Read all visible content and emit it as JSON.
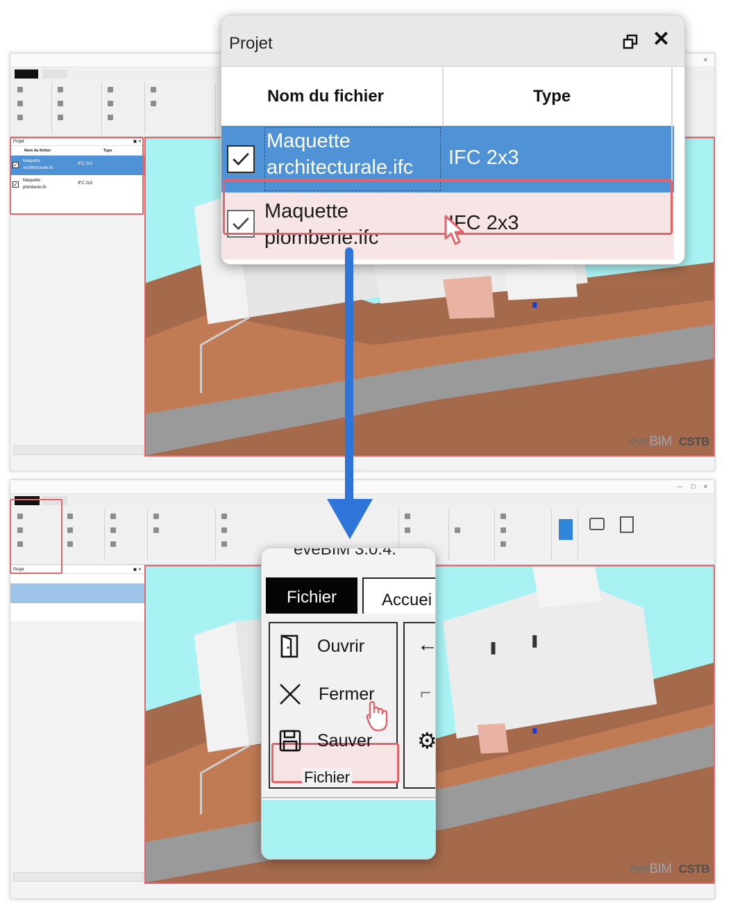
{
  "project_panel": {
    "title": "Projet",
    "columns": {
      "file_name": "Nom du fichier",
      "type": "Type"
    },
    "rows": [
      {
        "name_line1": "Maquette",
        "name_line2": "architecturale.ifc",
        "type": "IFC 2x3",
        "checked": true,
        "selected": true
      },
      {
        "name_line1": "Maquette",
        "name_line2": "plomberie.ifc",
        "type": "IFC 2x3",
        "checked": true,
        "selected": false
      }
    ]
  },
  "ribbon_menu": {
    "title_fragment": "eveBIM 3.0.4.",
    "tabs": {
      "file": "Fichier",
      "home": "Accuei"
    },
    "items": {
      "open": "Ouvrir",
      "close": "Fermer",
      "save": "Sauver"
    },
    "group_label": "Fichier"
  },
  "brand": {
    "eve": "eve",
    "bim": "BIM",
    "org": "CSTB"
  },
  "colors": {
    "selection_blue": "#4f92d6",
    "highlight_red": "#e4646c",
    "arrow_blue": "#2f74d8",
    "sky_cyan": "#a9f2f4",
    "terrain_brown": "#a46a4b"
  }
}
